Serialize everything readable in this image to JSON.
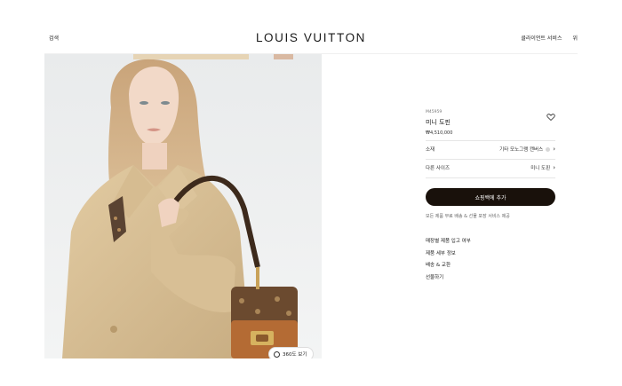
{
  "header": {
    "search_label": "검색",
    "brand": "LOUIS VUITTON",
    "client_services": "클라이언트 서비스",
    "wishlist": "위"
  },
  "media": {
    "view360_label": "360도 보기"
  },
  "product": {
    "sku": "M45959",
    "name": "미니 도핀",
    "price": "₩4,510,000",
    "material_label": "소재",
    "material_value": "기타 모노그램 캔버스",
    "size_label": "다른 사이즈",
    "size_value": "미니 도핀",
    "add_to_cart": "쇼핑백에 추가",
    "shipping_note": "모든 제품 무료 배송 & 선물 포장 서비스 제공"
  },
  "links": [
    "매장별 제품 입고 여부",
    "제품 세부 정보",
    "배송 & 교환",
    "선물하기"
  ],
  "colors": {
    "button": "#19110b",
    "coat": "#d9c096",
    "bag_canvas": "#6b4a2f",
    "bag_tan": "#b46b34"
  }
}
